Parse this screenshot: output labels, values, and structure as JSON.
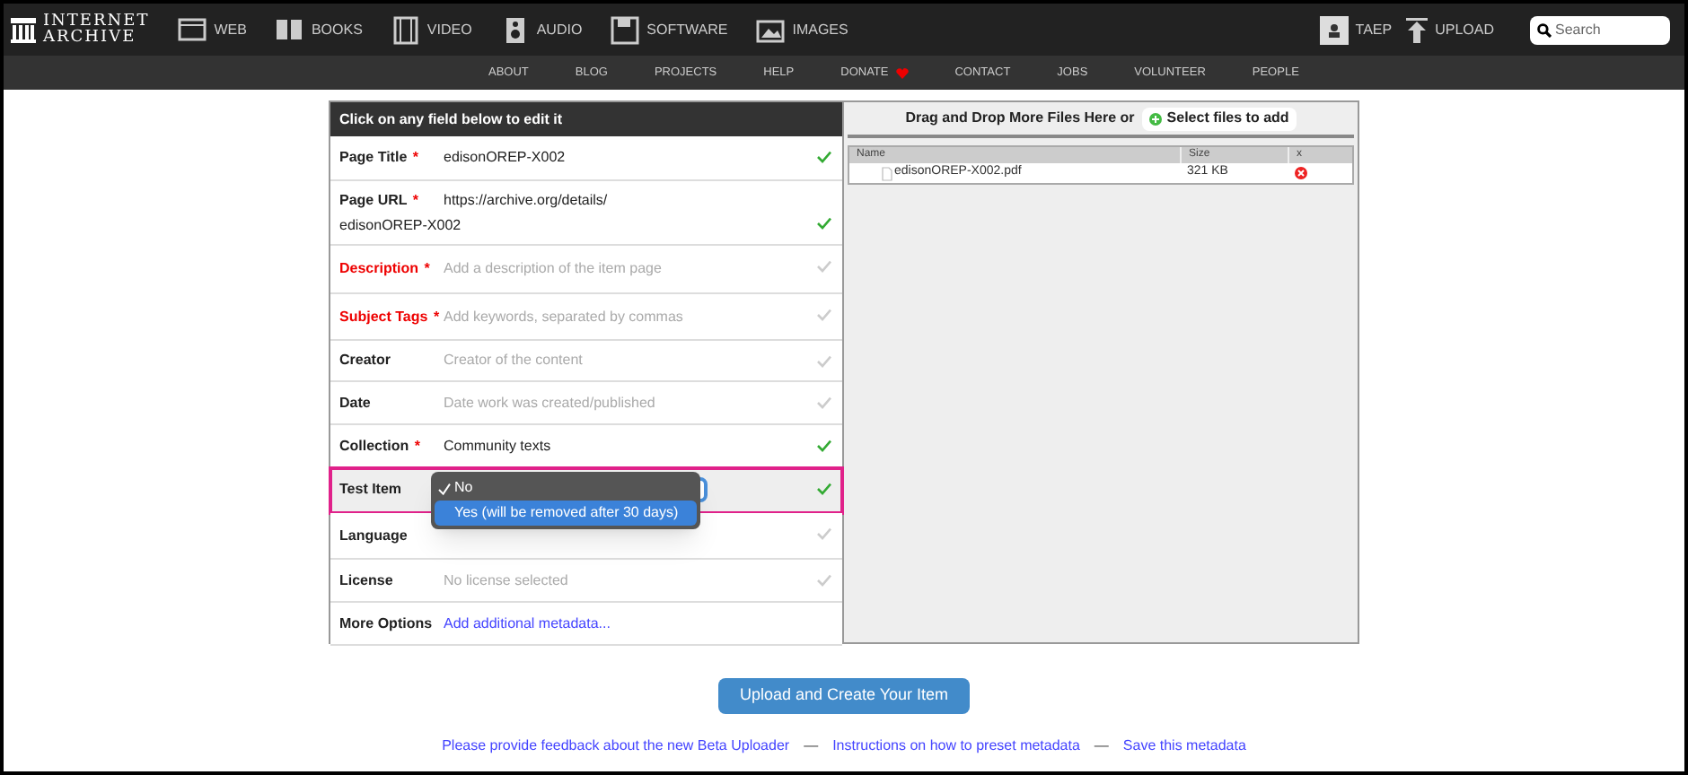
{
  "header": {
    "logo": [
      "INTERNET",
      "ARCHIVE"
    ],
    "nav": [
      {
        "label": "WEB",
        "kind": "web"
      },
      {
        "label": "BOOKS",
        "kind": "books"
      },
      {
        "label": "VIDEO",
        "kind": "video"
      },
      {
        "label": "AUDIO",
        "kind": "audio"
      },
      {
        "label": "SOFTWARE",
        "kind": "software"
      },
      {
        "label": "IMAGES",
        "kind": "images"
      }
    ],
    "user": "TAEP",
    "upload": "UPLOAD",
    "search": {
      "placeholder": "Search"
    }
  },
  "subnav": [
    {
      "label": "ABOUT",
      "heart": false
    },
    {
      "label": "BLOG",
      "heart": false
    },
    {
      "label": "PROJECTS",
      "heart": false
    },
    {
      "label": "HELP",
      "heart": false
    },
    {
      "label": "DONATE",
      "heart": true
    },
    {
      "label": "CONTACT",
      "heart": false
    },
    {
      "label": "JOBS",
      "heart": false
    },
    {
      "label": "VOLUNTEER",
      "heart": false
    },
    {
      "label": "PEOPLE",
      "heart": false
    }
  ],
  "form": {
    "title": "Click on any field below to edit it",
    "fields": [
      {
        "label": "Page Title",
        "required": "*",
        "missing": false,
        "value": "edisonOREP-X002",
        "valid": true,
        "selected": false
      },
      {
        "label": "Page URL",
        "required": "*",
        "missing": false,
        "value": "https://archive.org/details/",
        "value_2": "edisonOREP-X002",
        "valid": true,
        "selected": false
      },
      {
        "label": "Description",
        "required": "*",
        "missing": true,
        "placeholder": "Add a description of the item page",
        "valid": false,
        "selected": false
      },
      {
        "label": "Subject Tags",
        "required": "*",
        "missing": true,
        "placeholder": "Add keywords, separated by commas",
        "valid": false,
        "selected": false
      },
      {
        "label": "Creator",
        "missing": false,
        "placeholder": "Creator of the content",
        "valid": false,
        "selected": false
      },
      {
        "label": "Date",
        "missing": false,
        "placeholder": "Date work was created/published",
        "valid": false,
        "selected": false
      },
      {
        "label": "Collection",
        "required": "*",
        "missing": false,
        "value": "Community texts",
        "valid": true,
        "selected": false
      },
      {
        "label": "Test Item",
        "missing": false,
        "valid": true,
        "selected": true,
        "dropdown": [
          {
            "label": "No",
            "checked": true,
            "selected": false
          },
          {
            "label": "Yes (will be removed after 30 days)",
            "checked": false,
            "selected": true
          }
        ]
      },
      {
        "label": "Language",
        "missing": false,
        "valid": false,
        "selected": false
      },
      {
        "label": "License",
        "missing": false,
        "placeholder": "No license selected",
        "valid": false,
        "selected": false
      },
      {
        "label": "More Options",
        "missing": false,
        "link": "Add additional metadata...",
        "selected": false
      }
    ]
  },
  "files": {
    "prompt": "Drag and Drop More Files Here or",
    "select_button": "Select files to add",
    "columns": [
      "Name",
      "Size",
      "x"
    ],
    "rows": [
      {
        "name": "edisonOREP-X002.pdf",
        "size": "321 KB"
      }
    ]
  },
  "submit": "Upload and Create Your Item",
  "footer_links": [
    "Please provide feedback about the new Beta Uploader",
    "Instructions on how to preset metadata",
    "Save this metadata"
  ],
  "separator": "—"
}
